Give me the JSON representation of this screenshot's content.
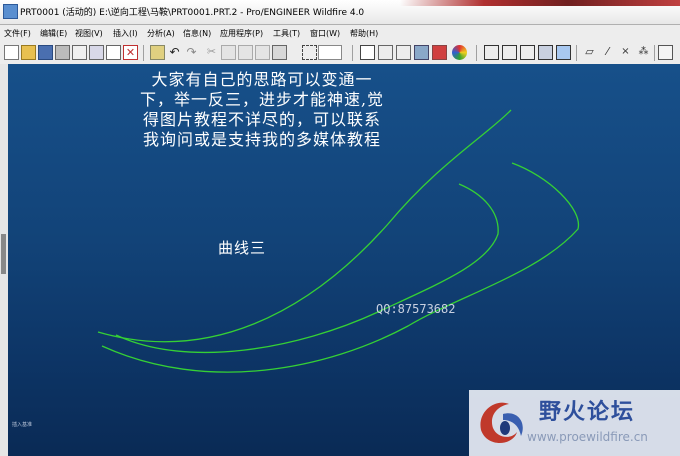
{
  "window": {
    "title": "PRT0001 (活动的) E:\\逆向工程\\马鞍\\PRT0001.PRT.2 - Pro/ENGINEER Wildfire 4.0"
  },
  "menu": [
    {
      "label": "文件(F)"
    },
    {
      "label": "编辑(E)"
    },
    {
      "label": "视图(V)"
    },
    {
      "label": "插入(I)"
    },
    {
      "label": "分析(A)"
    },
    {
      "label": "信息(N)"
    },
    {
      "label": "应用程序(P)"
    },
    {
      "label": "工具(T)"
    },
    {
      "label": "窗口(W)"
    },
    {
      "label": "帮助(H)"
    }
  ],
  "toolbar_icons": [
    "new-file-icon",
    "open-folder-icon",
    "save-icon",
    "print-icon",
    "email-icon",
    "copy-icon",
    "close-window-icon",
    "regenerate-icon",
    "undo-icon",
    "redo-icon",
    "cut-icon",
    "copy-icon",
    "paste-icon",
    "paste-special-icon",
    "select-box-icon",
    "repaint-icon",
    "zoom-in-icon",
    "zoom-out-icon",
    "refit-icon",
    "layers-icon",
    "appearance-icon",
    "wireframe-icon",
    "hidden-line-icon",
    "no-hidden-icon",
    "shading-icon",
    "enhanced-realism-icon",
    "datum-plane-icon",
    "datum-axis-icon",
    "datum-point-icon",
    "coordinate-system-icon",
    "saved-view-icon",
    "view-manager-icon"
  ],
  "viewport": {
    "note_lines": [
      "大家有自己的思路可以变通一",
      "下，举一反三，进步才能神速,觉",
      "得图片教程不详尽的，可以联系",
      "我询问或是支持我的多媒体教程"
    ],
    "curve_label": "曲线三",
    "qq": "QQ:87573682",
    "small_note": "插入基准",
    "curve_color": "#35d035"
  },
  "watermark": {
    "name": "野火论坛",
    "url": "www.proewildfire.cn"
  }
}
